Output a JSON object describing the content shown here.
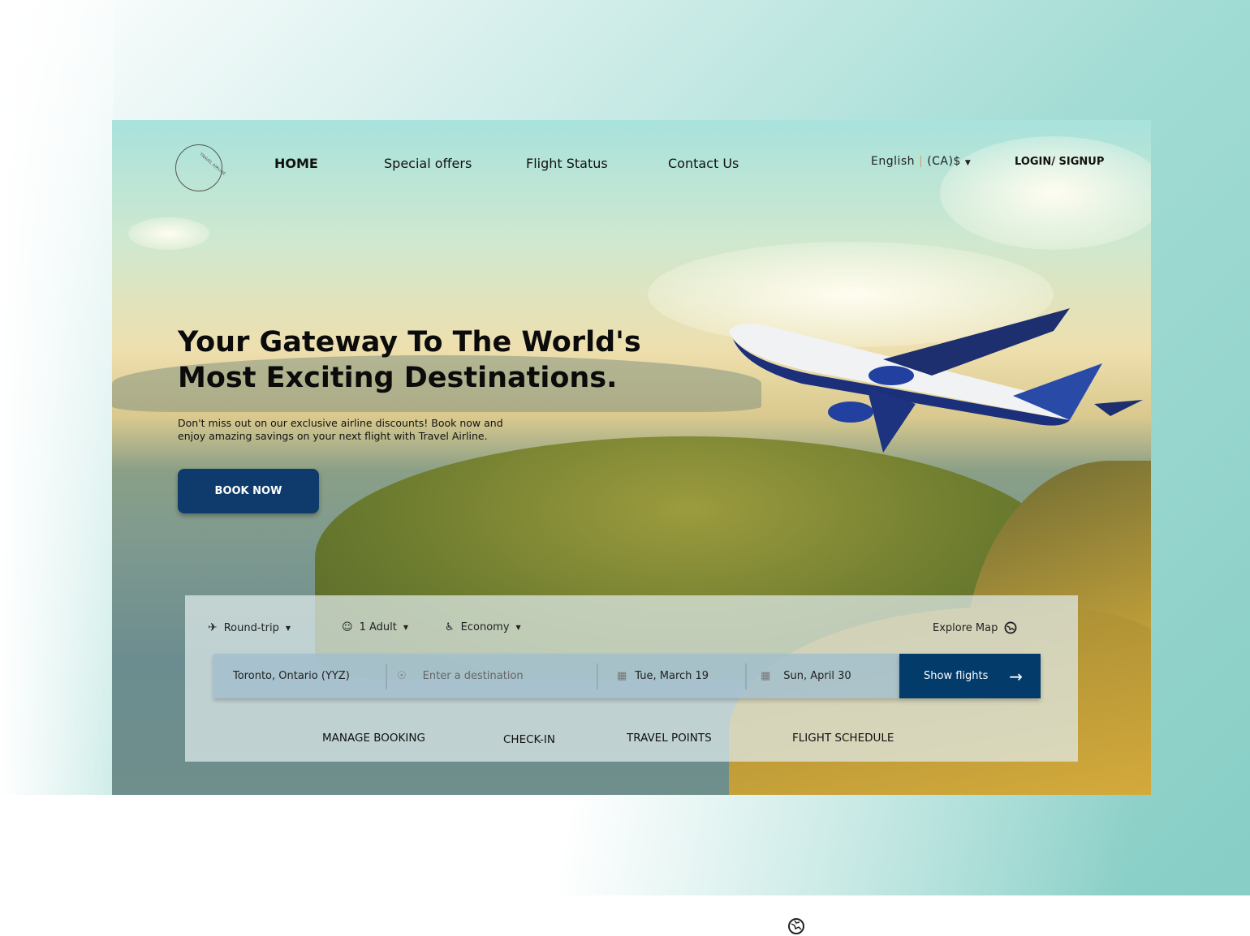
{
  "logo": {
    "text": "TRAVEL AIRLINE"
  },
  "nav": {
    "items": [
      "HOME",
      "Special offers",
      "Flight Status",
      "Contact Us"
    ],
    "language": "English",
    "separator": "|",
    "currency": "(CA)$",
    "login": "LOGIN/ SIGNUP"
  },
  "hero": {
    "title_line1": "Your Gateway To The World's",
    "title_line2": "Most Exciting Destinations.",
    "subtitle": "Don't miss out on our exclusive airline discounts! Book now and enjoy amazing savings on your next flight with Travel Airline.",
    "cta": "BOOK NOW"
  },
  "search": {
    "trip_type": "Round-trip",
    "passengers": "1 Adult",
    "cabin": "Economy",
    "explore_map": "Explore Map",
    "origin": "Toronto, Ontario (YYZ)",
    "destination_placeholder": "Enter a destination",
    "depart_date": "Tue, March 19",
    "return_date": "Sun, April 30",
    "submit": "Show flights"
  },
  "quick_links": [
    "MANAGE BOOKING",
    "CHECK-IN",
    "TRAVEL POINTS",
    "FLIGHT SCHEDULE"
  ],
  "colors": {
    "primary": "#033b6b",
    "accent_bg": "#86cdc5"
  }
}
